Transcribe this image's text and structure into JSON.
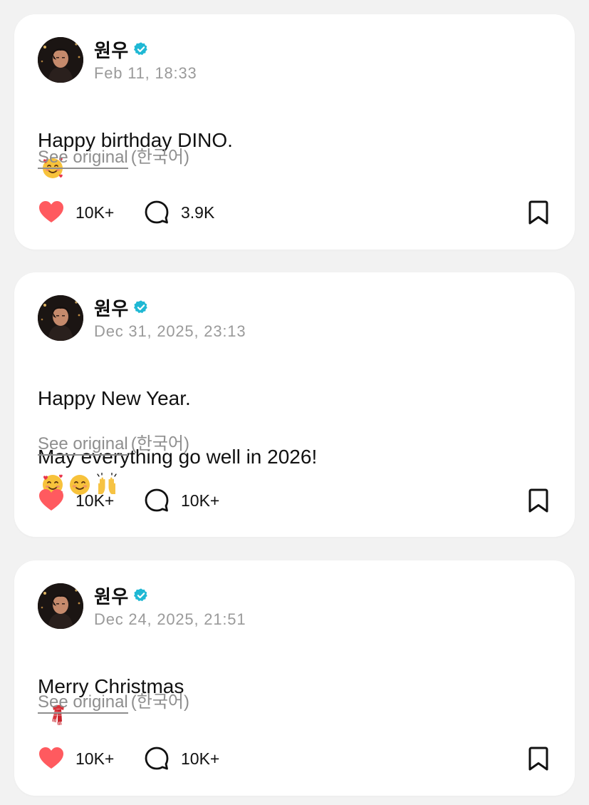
{
  "colors": {
    "background": "#f2f2f2",
    "card": "#ffffff",
    "heart": "#ff5a5f",
    "verified": "#1fb8d4",
    "muted_text": "#9a9a9a"
  },
  "posts": [
    {
      "author": "원우",
      "verified_icon": "verified-badge-icon",
      "timestamp": "Feb 11, 18:33",
      "body": "Happy birthday DINO.",
      "emojis": [
        "smiling-face-with-hearts"
      ],
      "see_original": "See original",
      "language": "(한국어)",
      "likes": "10K+",
      "comments": "3.9K"
    },
    {
      "author": "원우",
      "verified_icon": "verified-badge-icon",
      "timestamp": "Dec 31, 2025, 23:13",
      "body_lines": [
        "Happy New Year.",
        "May everything go well in 2026!"
      ],
      "emojis": [
        "smiling-face-with-hearts",
        "smiling-face",
        "raising-hands"
      ],
      "see_original": "See original",
      "language": "(한국어)",
      "likes": "10K+",
      "comments": "10K+"
    },
    {
      "author": "원우",
      "verified_icon": "verified-badge-icon",
      "timestamp": "Dec 24, 2025, 21:51",
      "body": "Merry Christmas",
      "emojis": [
        "scarf"
      ],
      "see_original": "See original",
      "language": "(한국어)",
      "likes": "10K+",
      "comments": "10K+"
    }
  ]
}
